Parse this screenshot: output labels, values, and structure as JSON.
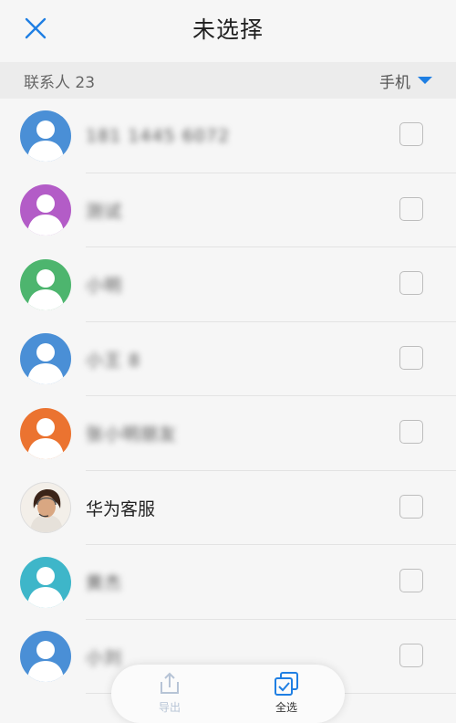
{
  "header": {
    "title": "未选择",
    "close_icon": "close-icon"
  },
  "section": {
    "count_label": "联系人 23",
    "filter_label": "手机",
    "filter_icon": "caret-down-icon"
  },
  "colors": {
    "accent": "#1f7fe3",
    "checkbox_border": "#bdbdbd"
  },
  "contacts": [
    {
      "name": "181 1445 6072",
      "avatar_color": "#4a8fd6",
      "blurred": true
    },
    {
      "name": "测试",
      "avatar_color": "#b35cc7",
      "blurred": true
    },
    {
      "name": "小明",
      "avatar_color": "#4db56e",
      "blurred": true
    },
    {
      "name": "小王 8",
      "avatar_color": "#4a8fd6",
      "blurred": true
    },
    {
      "name": "张小明朋友",
      "avatar_color": "#eb7330",
      "blurred": true
    },
    {
      "name": "华为客服",
      "avatar_color": "#ffffff",
      "blurred": false,
      "photo": true
    },
    {
      "name": "黄杰",
      "avatar_color": "#3eb6c9",
      "blurred": true
    },
    {
      "name": "小刘",
      "avatar_color": "#4a8fd6",
      "blurred": true
    }
  ],
  "bottom_actions": [
    {
      "label": "导出",
      "icon": "export-icon",
      "enabled": false
    },
    {
      "label": "全选",
      "icon": "select-all-icon",
      "enabled": true
    }
  ]
}
